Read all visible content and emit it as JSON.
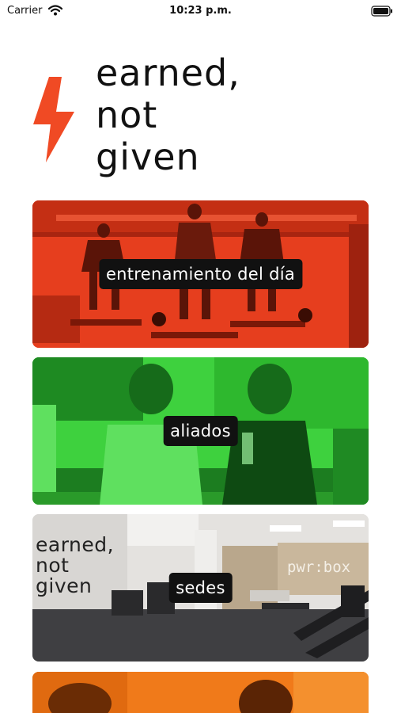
{
  "status_bar": {
    "carrier": "Carrier",
    "time": "10:23 p.m."
  },
  "header": {
    "headline_lines": [
      "earned,",
      "not",
      "given"
    ],
    "logo_icon": "lightning-bolt-icon",
    "accent_color": "#f04a24"
  },
  "cards": [
    {
      "label": "entrenamiento del día",
      "tint": "#ea4020"
    },
    {
      "label": "aliados",
      "tint": "#3ed13e"
    },
    {
      "label": "sedes",
      "tint": "#d9d6d2",
      "wall_text_lines": [
        "earned,",
        "not",
        "given"
      ],
      "sign_text": "pwr:box"
    },
    {
      "label": "",
      "tint": "#f07a1a"
    }
  ]
}
